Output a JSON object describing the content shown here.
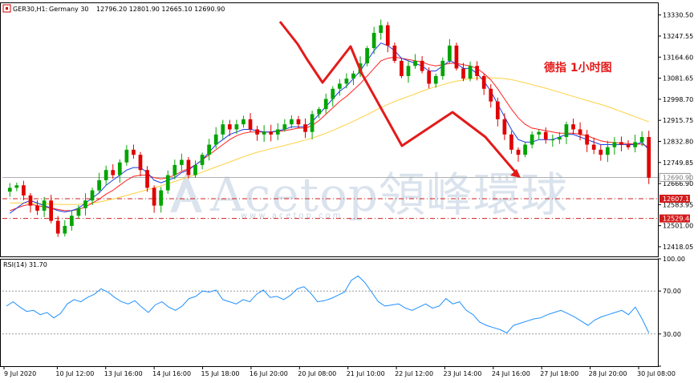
{
  "header": {
    "symbol": "GER30,H1:",
    "name": "Germany 30",
    "ohlc": "12796.20 12801.90 12665.10 12690.90"
  },
  "annotation": "德指 1小时图",
  "watermark": {
    "main": "Acetop領峰環球",
    "sub": "www.acetop.com"
  },
  "rsi_label": "RSI(14) 31.70",
  "colors": {
    "bull": "#00a400",
    "bear": "#e00000",
    "ma_fast": "#1a3ce6",
    "ma_mid": "#ff2020",
    "ma_slow": "#ffd040",
    "rsi": "#1e90ff",
    "level": "#d21c1c",
    "arrow": "#e41a1a"
  },
  "chart_data": [
    {
      "type": "candlestick",
      "title": "GER30,H1: Germany 30",
      "ylim": [
        12380,
        13380
      ],
      "y_ticks": [
        "13330.50",
        "13247.55",
        "13164.60",
        "13081.65",
        "12998.70",
        "12915.75",
        "12832.80",
        "12749.85",
        "12666.90",
        "12583.95",
        "12501.00",
        "12418.05"
      ],
      "price_labels": [
        {
          "label": "12690.90",
          "kind": "current"
        },
        {
          "label": "12607.17",
          "kind": "level"
        },
        {
          "label": "12529.44",
          "kind": "level"
        }
      ],
      "x_ticks": [
        "9 Jul 2020",
        "10 Jul 12:00",
        "13 Jul 16:00",
        "14 Jul 16:00",
        "15 Jul 18:00",
        "16 Jul 20:00",
        "20 Jul 08:00",
        "21 Jul 10:00",
        "22 Jul 12:00",
        "23 Jul 14:00",
        "24 Jul 16:00",
        "27 Jul 18:00",
        "28 Jul 20:00",
        "30 Jul 08:00"
      ],
      "close": [
        12650,
        12660,
        12620,
        12580,
        12560,
        12600,
        12520,
        12470,
        12500,
        12540,
        12570,
        12600,
        12640,
        12680,
        12720,
        12700,
        12750,
        12800,
        12780,
        12720,
        12650,
        12580,
        12640,
        12700,
        12740,
        12760,
        12700,
        12740,
        12780,
        12820,
        12860,
        12900,
        12880,
        12900,
        12920,
        12880,
        12860,
        12870,
        12860,
        12880,
        12900,
        12920,
        12900,
        12870,
        12940,
        12960,
        13000,
        13040,
        13060,
        13080,
        13100,
        13140,
        13200,
        13260,
        13290,
        13210,
        13150,
        13090,
        13130,
        13150,
        13110,
        13060,
        13090,
        13150,
        13210,
        13120,
        13080,
        13130,
        13090,
        13040,
        12990,
        12920,
        12860,
        12800,
        12780,
        12820,
        12860,
        12870,
        12840,
        12840,
        12850,
        12900,
        12880,
        12860,
        12820,
        12800,
        12780,
        12810,
        12830,
        12820,
        12810,
        12830,
        12850,
        12690
      ],
      "ma_fast": [
        12550,
        12570,
        12590,
        12600,
        12590,
        12580,
        12570,
        12560,
        12555,
        12560,
        12570,
        12590,
        12610,
        12630,
        12660,
        12680,
        12700,
        12720,
        12730,
        12730,
        12710,
        12680,
        12670,
        12680,
        12690,
        12710,
        12720,
        12740,
        12760,
        12790,
        12820,
        12840,
        12860,
        12870,
        12880,
        12880,
        12875,
        12870,
        12870,
        12875,
        12880,
        12890,
        12890,
        12890,
        12910,
        12940,
        12970,
        13000,
        13030,
        13050,
        13080,
        13110,
        13150,
        13190,
        13220,
        13210,
        13190,
        13160,
        13150,
        13140,
        13130,
        13110,
        13110,
        13130,
        13150,
        13140,
        13120,
        13120,
        13100,
        13070,
        13030,
        12980,
        12930,
        12880,
        12840,
        12830,
        12830,
        12840,
        12840,
        12840,
        12850,
        12860,
        12860,
        12850,
        12840,
        12830,
        12820,
        12820,
        12820,
        12820,
        12820,
        12820,
        12830,
        12800
      ],
      "ma_mid": [
        12560,
        12570,
        12580,
        12585,
        12580,
        12575,
        12570,
        12565,
        12560,
        12560,
        12565,
        12575,
        12590,
        12605,
        12625,
        12640,
        12660,
        12680,
        12695,
        12700,
        12700,
        12690,
        12685,
        12690,
        12700,
        12715,
        12725,
        12740,
        12760,
        12780,
        12800,
        12820,
        12840,
        12855,
        12865,
        12870,
        12870,
        12870,
        12870,
        12872,
        12875,
        12880,
        12885,
        12885,
        12895,
        12915,
        12940,
        12965,
        12990,
        13010,
        13035,
        13060,
        13090,
        13120,
        13150,
        13160,
        13165,
        13160,
        13155,
        13150,
        13145,
        13135,
        13130,
        13135,
        13140,
        13140,
        13135,
        13130,
        13120,
        13100,
        13075,
        13040,
        13000,
        12960,
        12925,
        12900,
        12885,
        12880,
        12875,
        12870,
        12865,
        12865,
        12865,
        12860,
        12855,
        12845,
        12835,
        12830,
        12828,
        12826,
        12824,
        12822,
        12822,
        12810
      ],
      "ma_slow": [
        12590,
        12590,
        12590,
        12589,
        12588,
        12587,
        12586,
        12585,
        12584,
        12584,
        12585,
        12587,
        12590,
        12594,
        12600,
        12606,
        12613,
        12620,
        12628,
        12635,
        12642,
        12650,
        12658,
        12666,
        12675,
        12684,
        12693,
        12702,
        12712,
        12722,
        12732,
        12742,
        12752,
        12762,
        12772,
        12782,
        12790,
        12797,
        12804,
        12810,
        12817,
        12824,
        12831,
        12838,
        12846,
        12855,
        12865,
        12876,
        12888,
        12900,
        12912,
        12925,
        12938,
        12952,
        12966,
        12978,
        12990,
        13000,
        13010,
        13020,
        13030,
        13040,
        13048,
        13056,
        13064,
        13070,
        13075,
        13080,
        13082,
        13083,
        13083,
        13082,
        13080,
        13076,
        13070,
        13063,
        13056,
        13049,
        13042,
        13034,
        13026,
        13018,
        13010,
        13002,
        12994,
        12986,
        12978,
        12970,
        12960,
        12950,
        12940,
        12930,
        12920,
        12910
      ]
    },
    {
      "type": "line",
      "title": "RSI(14)",
      "ylim": [
        0,
        100
      ],
      "y_ticks": [
        100,
        70,
        30,
        0
      ],
      "level_lines": [
        70,
        30
      ],
      "values": [
        56,
        60,
        55,
        51,
        52,
        48,
        50,
        45,
        49,
        58,
        62,
        60,
        64,
        67,
        72,
        69,
        64,
        60,
        58,
        61,
        55,
        50,
        57,
        60,
        55,
        52,
        56,
        63,
        65,
        70,
        69,
        71,
        62,
        60,
        58,
        62,
        60,
        67,
        71,
        64,
        65,
        62,
        66,
        72,
        74,
        68,
        60,
        61,
        63,
        66,
        69,
        80,
        84,
        78,
        69,
        60,
        56,
        57,
        58,
        54,
        52,
        55,
        58,
        54,
        56,
        63,
        58,
        60,
        52,
        48,
        41,
        38,
        36,
        34,
        31,
        38,
        40,
        42,
        44,
        45,
        48,
        50,
        52,
        49,
        46,
        42,
        38,
        43,
        46,
        48,
        50,
        52,
        48,
        55,
        44,
        31
      ],
      "value_label": "31.70"
    }
  ]
}
